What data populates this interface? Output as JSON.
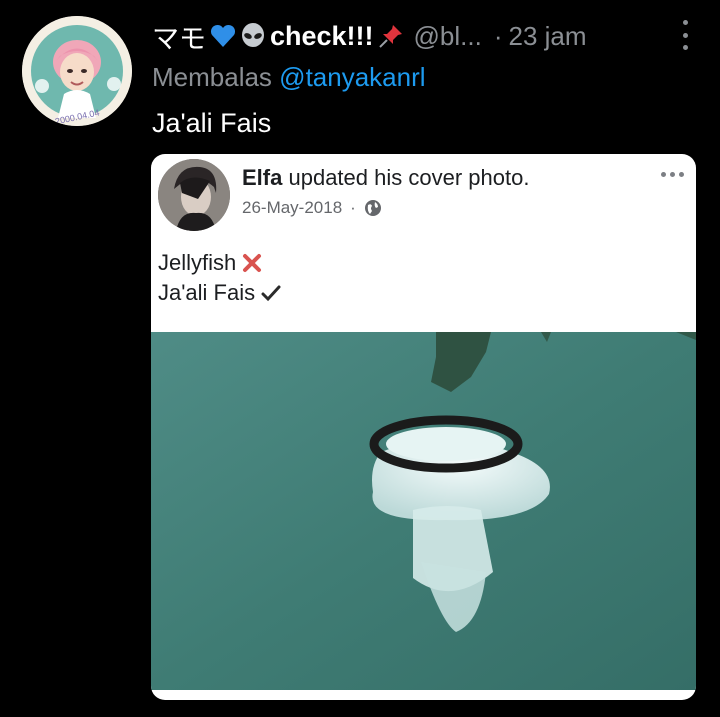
{
  "tweet": {
    "author_name_prefix": "マモ",
    "author_name_suffix": "check!!!",
    "author_handle": "@bl...",
    "time": "23 jam",
    "reply_label": "Membalas",
    "reply_mention": "@tanyakanrl",
    "text": "Ja'ali Fais",
    "avatar_ring_text": "2000.04.04",
    "icons": [
      "blue-heart-icon",
      "alien-icon",
      "pushpin-icon",
      "more-options-icon"
    ]
  },
  "quoted_post": {
    "author": "Elfa",
    "action": "updated his cover photo.",
    "date": "26-May-2018",
    "separator": "·",
    "line1_text": "Jellyfish",
    "line2_text": "Ja'ali Fais",
    "icons": [
      "cross-mark-icon",
      "check-mark-icon",
      "globe-icon",
      "more-options-icon"
    ]
  },
  "colors": {
    "background": "#000000",
    "secondary_text": "#8b8f94",
    "link_blue": "#1d9bf0",
    "card_bg": "#ffffff",
    "water": "#3f7c74"
  }
}
